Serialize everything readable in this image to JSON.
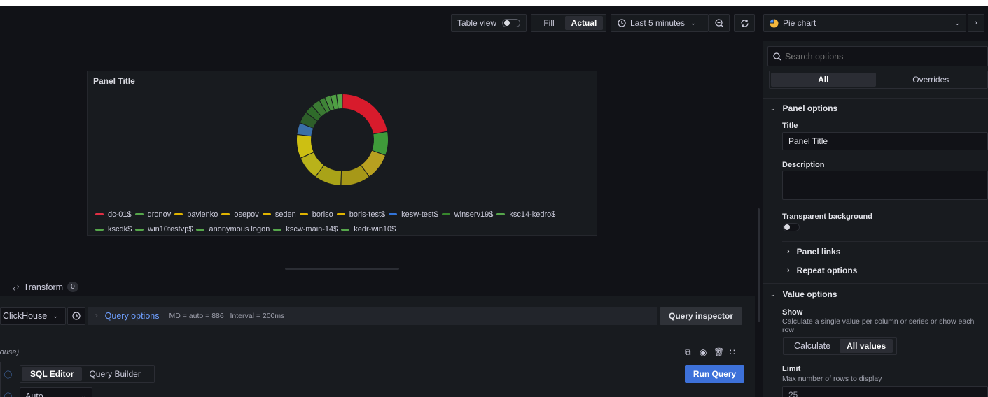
{
  "toolbar": {
    "table_view_label": "Table view",
    "fill_label": "Fill",
    "actual_label": "Actual",
    "time_range_label": "Last 5 minutes",
    "visualization_label": "Pie chart"
  },
  "panel": {
    "title": "Panel Title",
    "legend": [
      {
        "label": "dc-01$",
        "color": "#e02f44"
      },
      {
        "label": "dronov",
        "color": "#56a64b"
      },
      {
        "label": "pavlenko",
        "color": "#e0b400"
      },
      {
        "label": "osepov",
        "color": "#e0b400"
      },
      {
        "label": "seden",
        "color": "#e0b400"
      },
      {
        "label": "boriso",
        "color": "#e0b400"
      },
      {
        "label": "boris-test$",
        "color": "#e0b400"
      },
      {
        "label": "kesw-test$",
        "color": "#3274d9"
      },
      {
        "label": "winserv19$",
        "color": "#37872d"
      },
      {
        "label": "ksc14-kedro$",
        "color": "#56a64b"
      },
      {
        "label": "kscdk$",
        "color": "#56a64b"
      },
      {
        "label": "win10testvp$",
        "color": "#56a64b"
      },
      {
        "label": "anonymous logon",
        "color": "#56a64b"
      },
      {
        "label": "kscw-main-14$",
        "color": "#56a64b"
      },
      {
        "label": "kedr-win10$",
        "color": "#56a64b"
      }
    ]
  },
  "transform": {
    "label": "Transform",
    "count": "0"
  },
  "query": {
    "datasource": "ClickHouse",
    "options_label": "Query options",
    "meta": "MD = auto = 886   Interval = 200ms",
    "inspector_label": "Query inspector",
    "row_name": "(ouse)",
    "tabs": [
      "SQL Editor",
      "Query Builder"
    ],
    "run_label": "Run Query",
    "format_value": "Auto"
  },
  "options": {
    "search_placeholder": "Search options",
    "tab_all": "All",
    "tab_overrides": "Overrides",
    "panel_options": "Panel options",
    "title_label": "Title",
    "title_value": "Panel Title",
    "description_label": "Description",
    "transparent_label": "Transparent background",
    "panel_links": "Panel links",
    "repeat_options": "Repeat options",
    "value_options": "Value options",
    "show_label": "Show",
    "show_desc": "Calculate a single value per column or series or show each row",
    "calculate_label": "Calculate",
    "all_values_label": "All values",
    "limit_label": "Limit",
    "limit_desc": "Max number of rows to display",
    "limit_value": "25"
  },
  "chart_data": {
    "type": "pie",
    "donut": true,
    "categories": [
      "dc-01$",
      "dronov",
      "pavlenko",
      "osepov",
      "seden",
      "boriso",
      "boris-test$",
      "kesw-test$",
      "winserv19$",
      "ksc14-kedro$",
      "kscdk$",
      "win10testvp$",
      "anonymous logon",
      "kscw-main-14$",
      "kedr-win10$"
    ],
    "values": [
      21,
      8,
      9,
      10,
      9,
      8,
      8,
      4,
      4,
      3,
      3,
      2,
      2,
      2,
      2
    ],
    "colors": [
      "#d81b2c",
      "#3f9b3a",
      "#b8a020",
      "#a79818",
      "#a9a318",
      "#b9b21a",
      "#cdbf12",
      "#3a6fa8",
      "#2e5e2a",
      "#2f6b2a",
      "#3b7a33",
      "#3f8437",
      "#4b9340",
      "#4fa043",
      "#56a64b"
    ]
  }
}
